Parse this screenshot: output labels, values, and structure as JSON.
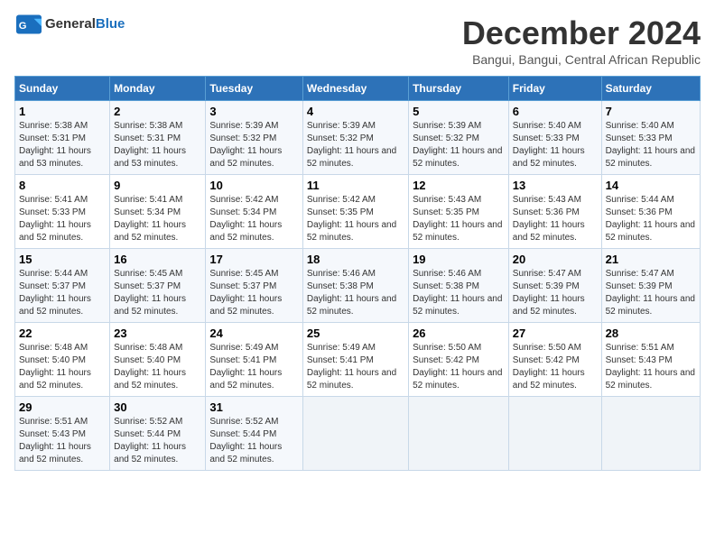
{
  "header": {
    "logo_text_general": "General",
    "logo_text_blue": "Blue",
    "month_title": "December 2024",
    "location": "Bangui, Bangui, Central African Republic"
  },
  "days_of_week": [
    "Sunday",
    "Monday",
    "Tuesday",
    "Wednesday",
    "Thursday",
    "Friday",
    "Saturday"
  ],
  "weeks": [
    [
      {
        "day": "1",
        "sunrise": "5:38 AM",
        "sunset": "5:31 PM",
        "daylight": "11 hours and 53 minutes."
      },
      {
        "day": "2",
        "sunrise": "5:38 AM",
        "sunset": "5:31 PM",
        "daylight": "11 hours and 53 minutes."
      },
      {
        "day": "3",
        "sunrise": "5:39 AM",
        "sunset": "5:32 PM",
        "daylight": "11 hours and 52 minutes."
      },
      {
        "day": "4",
        "sunrise": "5:39 AM",
        "sunset": "5:32 PM",
        "daylight": "11 hours and 52 minutes."
      },
      {
        "day": "5",
        "sunrise": "5:39 AM",
        "sunset": "5:32 PM",
        "daylight": "11 hours and 52 minutes."
      },
      {
        "day": "6",
        "sunrise": "5:40 AM",
        "sunset": "5:33 PM",
        "daylight": "11 hours and 52 minutes."
      },
      {
        "day": "7",
        "sunrise": "5:40 AM",
        "sunset": "5:33 PM",
        "daylight": "11 hours and 52 minutes."
      }
    ],
    [
      {
        "day": "8",
        "sunrise": "5:41 AM",
        "sunset": "5:33 PM",
        "daylight": "11 hours and 52 minutes."
      },
      {
        "day": "9",
        "sunrise": "5:41 AM",
        "sunset": "5:34 PM",
        "daylight": "11 hours and 52 minutes."
      },
      {
        "day": "10",
        "sunrise": "5:42 AM",
        "sunset": "5:34 PM",
        "daylight": "11 hours and 52 minutes."
      },
      {
        "day": "11",
        "sunrise": "5:42 AM",
        "sunset": "5:35 PM",
        "daylight": "11 hours and 52 minutes."
      },
      {
        "day": "12",
        "sunrise": "5:43 AM",
        "sunset": "5:35 PM",
        "daylight": "11 hours and 52 minutes."
      },
      {
        "day": "13",
        "sunrise": "5:43 AM",
        "sunset": "5:36 PM",
        "daylight": "11 hours and 52 minutes."
      },
      {
        "day": "14",
        "sunrise": "5:44 AM",
        "sunset": "5:36 PM",
        "daylight": "11 hours and 52 minutes."
      }
    ],
    [
      {
        "day": "15",
        "sunrise": "5:44 AM",
        "sunset": "5:37 PM",
        "daylight": "11 hours and 52 minutes."
      },
      {
        "day": "16",
        "sunrise": "5:45 AM",
        "sunset": "5:37 PM",
        "daylight": "11 hours and 52 minutes."
      },
      {
        "day": "17",
        "sunrise": "5:45 AM",
        "sunset": "5:37 PM",
        "daylight": "11 hours and 52 minutes."
      },
      {
        "day": "18",
        "sunrise": "5:46 AM",
        "sunset": "5:38 PM",
        "daylight": "11 hours and 52 minutes."
      },
      {
        "day": "19",
        "sunrise": "5:46 AM",
        "sunset": "5:38 PM",
        "daylight": "11 hours and 52 minutes."
      },
      {
        "day": "20",
        "sunrise": "5:47 AM",
        "sunset": "5:39 PM",
        "daylight": "11 hours and 52 minutes."
      },
      {
        "day": "21",
        "sunrise": "5:47 AM",
        "sunset": "5:39 PM",
        "daylight": "11 hours and 52 minutes."
      }
    ],
    [
      {
        "day": "22",
        "sunrise": "5:48 AM",
        "sunset": "5:40 PM",
        "daylight": "11 hours and 52 minutes."
      },
      {
        "day": "23",
        "sunrise": "5:48 AM",
        "sunset": "5:40 PM",
        "daylight": "11 hours and 52 minutes."
      },
      {
        "day": "24",
        "sunrise": "5:49 AM",
        "sunset": "5:41 PM",
        "daylight": "11 hours and 52 minutes."
      },
      {
        "day": "25",
        "sunrise": "5:49 AM",
        "sunset": "5:41 PM",
        "daylight": "11 hours and 52 minutes."
      },
      {
        "day": "26",
        "sunrise": "5:50 AM",
        "sunset": "5:42 PM",
        "daylight": "11 hours and 52 minutes."
      },
      {
        "day": "27",
        "sunrise": "5:50 AM",
        "sunset": "5:42 PM",
        "daylight": "11 hours and 52 minutes."
      },
      {
        "day": "28",
        "sunrise": "5:51 AM",
        "sunset": "5:43 PM",
        "daylight": "11 hours and 52 minutes."
      }
    ],
    [
      {
        "day": "29",
        "sunrise": "5:51 AM",
        "sunset": "5:43 PM",
        "daylight": "11 hours and 52 minutes."
      },
      {
        "day": "30",
        "sunrise": "5:52 AM",
        "sunset": "5:44 PM",
        "daylight": "11 hours and 52 minutes."
      },
      {
        "day": "31",
        "sunrise": "5:52 AM",
        "sunset": "5:44 PM",
        "daylight": "11 hours and 52 minutes."
      },
      null,
      null,
      null,
      null
    ]
  ],
  "labels": {
    "sunrise": "Sunrise:",
    "sunset": "Sunset:",
    "daylight": "Daylight:"
  }
}
